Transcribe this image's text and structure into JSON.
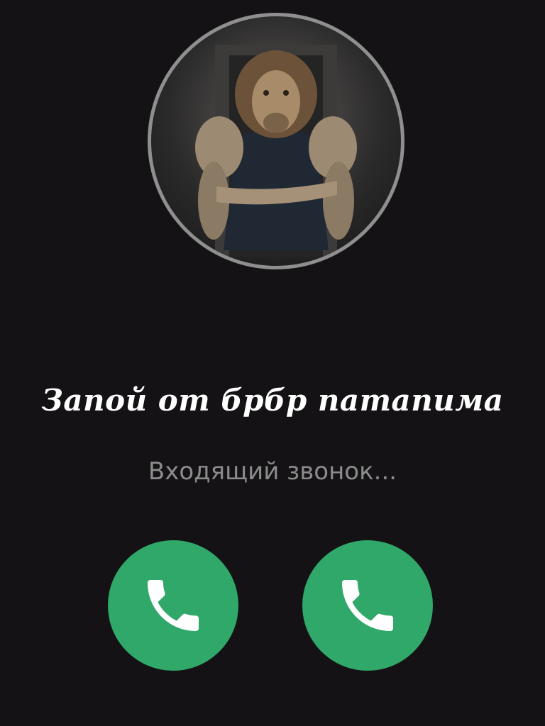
{
  "call": {
    "caller_name": "Запой от брбр патапима",
    "status": "Входящий звонок..."
  },
  "avatar": {
    "description_icon": "lion-bodybuilder-avatar"
  },
  "buttons": [
    {
      "icon": "phone-icon",
      "color": "#2fa86a"
    },
    {
      "icon": "phone-icon",
      "color": "#2fa86a"
    }
  ],
  "colors": {
    "background": "#141214",
    "accept_green": "#2fa86a",
    "status_gray": "#8c8c8c",
    "avatar_ring": "#8f8f8f"
  }
}
